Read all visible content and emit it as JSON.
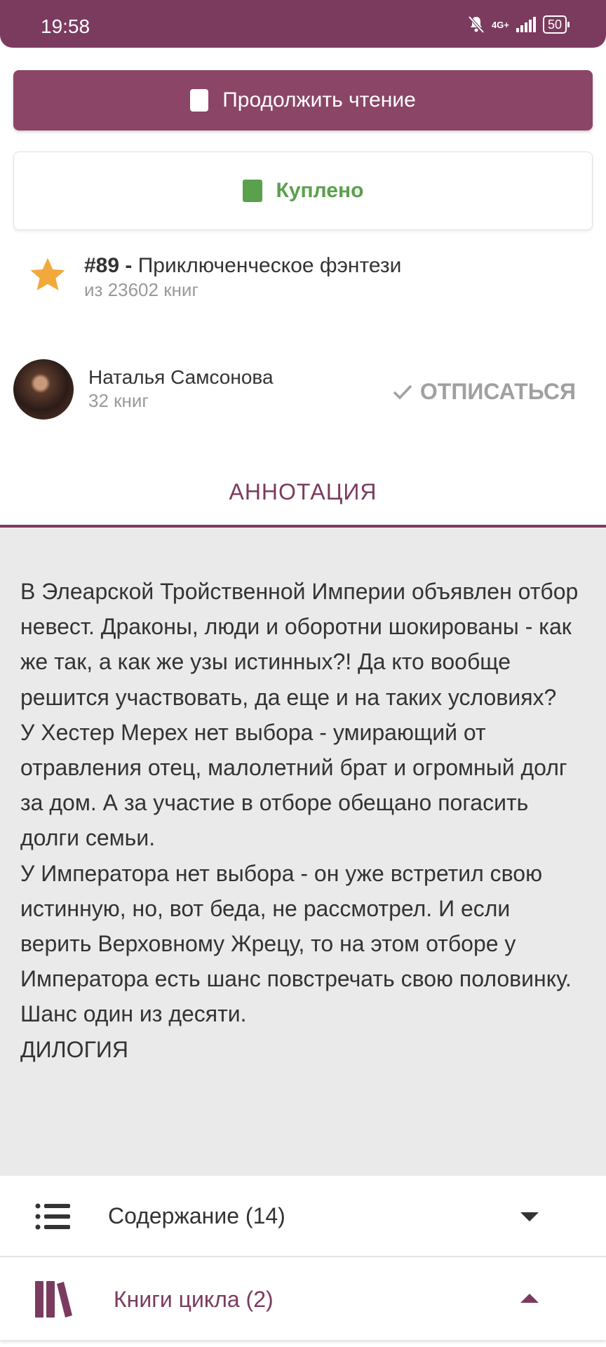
{
  "status_bar": {
    "time": "19:58",
    "network": "4G+",
    "battery": "50"
  },
  "actions": {
    "continue_label": "Продолжить чтение",
    "bought_label": "Куплено"
  },
  "rating": {
    "rank": "#89 -",
    "genre": "Приключенческое фэнтези",
    "total": "из 23602 книг"
  },
  "author": {
    "name": "Наталья Самсонова",
    "books": "32 книг",
    "unsubscribe_label": "ОТПИСАТЬСЯ"
  },
  "tabs": {
    "annotation": "АННОТАЦИЯ"
  },
  "annotation_text": "В Элеарской Тройственной Империи объявлен отбор невест. Драконы, люди и оборотни шокированы - как же так, а как же узы истинных?! Да кто вообще решится участвовать, да еще и на таких условиях?\nУ Хестер Мерех нет выбора - умирающий от отравления отец, малолетний брат и огромный долг за дом. А за участие в отборе обещано погасить долги семьи.\nУ Императора нет выбора - он уже встретил свою истинную, но, вот беда, не рассмотрел. И если верить Верховному Жрецу, то на этом отборе у Императора есть шанс повстречать свою половинку. Шанс один из десяти.\nДИЛОГИЯ",
  "sections": {
    "contents_label": "Содержание (14)",
    "series_label": "Книги цикла (2)"
  },
  "colors": {
    "accent": "#7b3b5e",
    "button": "#8b4566",
    "bought": "#5ba04c",
    "star": "#f2a93b"
  }
}
